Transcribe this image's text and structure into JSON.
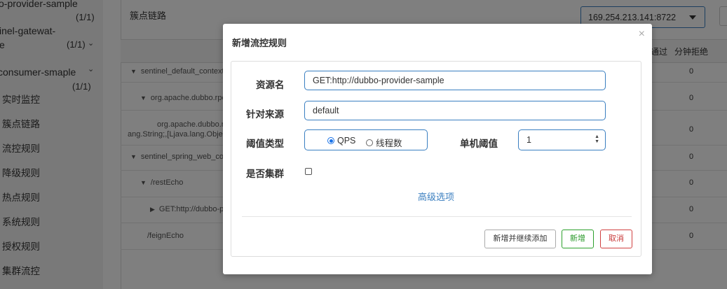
{
  "sidebar": {
    "apps": [
      {
        "name": "o-provider-sample",
        "count": "(1/1)"
      },
      {
        "name_line1": "inel-gatewat-",
        "name_line2": "e",
        "count": "(1/1)"
      },
      {
        "name": "consumer-smaple",
        "count": "(1/1)"
      }
    ],
    "menu": [
      "实时监控",
      "簇点链路",
      "流控规则",
      "降级规则",
      "热点规则",
      "系统规则",
      "授权规则",
      "集群流控"
    ]
  },
  "panel": {
    "title": "簇点链路",
    "machine": "169.254.213.141:8722",
    "columns": {
      "pass_partial": "通过",
      "reject": "分钟拒绝"
    },
    "rows": [
      {
        "text": "sentinel_default_context",
        "indent": 0,
        "expander": "▼",
        "value": "0"
      },
      {
        "text": "org.apache.dubbo.rpc",
        "indent": 1,
        "expander": "▼",
        "value": "0"
      },
      {
        "text": "org.apache.dubbo.r",
        "text2": "ang.String;,[Ljava.lang.Objec",
        "indent": 2,
        "expander": "",
        "value": "0"
      },
      {
        "text": "sentinel_spring_web_co",
        "indent": 0,
        "expander": "▼",
        "value": "0"
      },
      {
        "text": "/restEcho",
        "indent": 1,
        "expander": "▼",
        "value": "0"
      },
      {
        "text": "GET:http://dubbo-pr",
        "indent": 2,
        "expander": "▶",
        "value": "0"
      },
      {
        "text": "/feignEcho",
        "indent": 1,
        "expander": "",
        "value": "0"
      }
    ]
  },
  "modal": {
    "title": "新增流控规则",
    "close": "×",
    "resource_label": "资源名",
    "resource_value": "GET:http://dubbo-provider-sample",
    "origin_label": "针对来源",
    "origin_value": "default",
    "threshold_type_label": "阈值类型",
    "threshold_type_options": [
      "QPS",
      "线程数"
    ],
    "threshold_type_selected": "QPS",
    "single_threshold_label": "单机阈值",
    "single_threshold_value": "1",
    "cluster_label": "是否集群",
    "cluster_checked": false,
    "advanced_link": "高级选项",
    "buttons": {
      "continue": "新增并继续添加",
      "add": "新增",
      "cancel": "取消"
    }
  }
}
